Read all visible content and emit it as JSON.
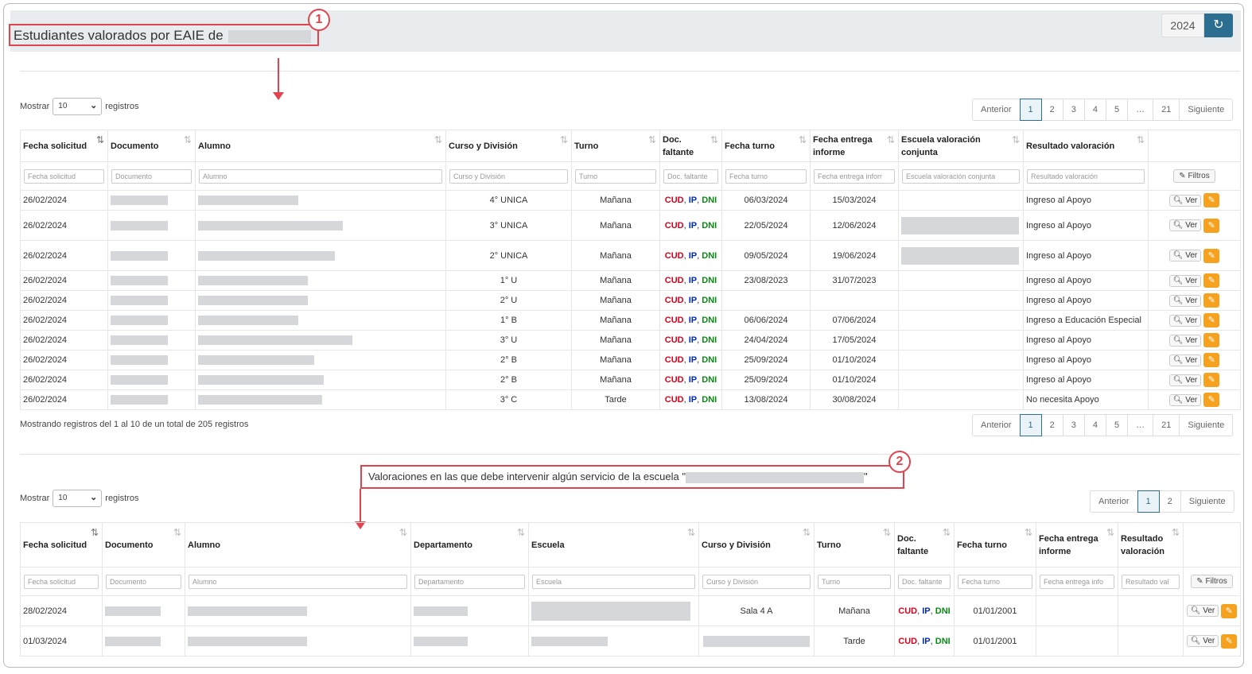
{
  "header": {
    "title": "Estudiantes valorados por EAIE de",
    "year": "2024",
    "badge1": "1",
    "badge2": "2"
  },
  "icons": {
    "refresh": "refresh-icon",
    "sort": "sort-icon",
    "search": "search-icon",
    "edit": "pencil-icon",
    "eraser": "eraser-icon",
    "chevron": "chevron-down-icon"
  },
  "colors": {
    "accent": "#2c6e8f",
    "callout": "#e0454f",
    "edit": "#f6a21e",
    "cud": "#d9001b",
    "ip": "#0029c4",
    "dni": "#0a8a14"
  },
  "table1": {
    "show_prefix": "Mostrar",
    "show_value": "10",
    "show_suffix": "registros",
    "pager": [
      "Anterior",
      "1",
      "2",
      "3",
      "4",
      "5",
      "…",
      "21",
      "Siguiente"
    ],
    "headers": [
      "Fecha solicitud",
      "Documento",
      "Alumno",
      "Curso y División",
      "Turno",
      "Doc. faltante",
      "Fecha turno",
      "Fecha entrega informe",
      "Escuela valoración conjunta",
      "Resultado valoración",
      ""
    ],
    "filters": [
      "Fecha solicitud",
      "Documento",
      "Alumno",
      "Curso y División",
      "Turno",
      "Doc. faltante",
      "Fecha turno",
      "Fecha entrega inforr",
      "Escuela valoración conjunta",
      "Resultado valoración"
    ],
    "filtros_label": "Filtros",
    "rows": [
      {
        "fecha": "26/02/2024",
        "curso": "4° UNICA",
        "turno": "Mañana",
        "fturno": "06/03/2024",
        "fentrega": "15/03/2024",
        "resultado": "Ingreso al Apoyo"
      },
      {
        "fecha": "26/02/2024",
        "curso": "3° UNICA",
        "turno": "Mañana",
        "fturno": "22/05/2024",
        "fentrega": "12/06/2024",
        "resultado": "Ingreso al Apoyo"
      },
      {
        "fecha": "26/02/2024",
        "curso": "2° UNICA",
        "turno": "Mañana",
        "fturno": "09/05/2024",
        "fentrega": "19/06/2024",
        "resultado": "Ingreso al Apoyo"
      },
      {
        "fecha": "26/02/2024",
        "curso": "1° U",
        "turno": "Mañana",
        "fturno": "23/08/2023",
        "fentrega": "31/07/2023",
        "resultado": "Ingreso al Apoyo"
      },
      {
        "fecha": "26/02/2024",
        "curso": "2° U",
        "turno": "Mañana",
        "fturno": "",
        "fentrega": "",
        "resultado": "Ingreso al Apoyo"
      },
      {
        "fecha": "26/02/2024",
        "curso": "1° B",
        "turno": "Mañana",
        "fturno": "06/06/2024",
        "fentrega": "07/06/2024",
        "resultado": "Ingreso a Educación Especial"
      },
      {
        "fecha": "26/02/2024",
        "curso": "3° U",
        "turno": "Mañana",
        "fturno": "24/04/2024",
        "fentrega": "17/05/2024",
        "resultado": "Ingreso al Apoyo"
      },
      {
        "fecha": "26/02/2024",
        "curso": "2° B",
        "turno": "Mañana",
        "fturno": "25/09/2024",
        "fentrega": "01/10/2024",
        "resultado": "Ingreso al Apoyo"
      },
      {
        "fecha": "26/02/2024",
        "curso": "2° B",
        "turno": "Mañana",
        "fturno": "25/09/2024",
        "fentrega": "01/10/2024",
        "resultado": "Ingreso al Apoyo"
      },
      {
        "fecha": "26/02/2024",
        "curso": "3° C",
        "turno": "Tarde",
        "fturno": "13/08/2024",
        "fentrega": "30/08/2024",
        "resultado": "No necesita Apoyo"
      }
    ],
    "doc_parts": [
      "CUD",
      "IP",
      "DNI"
    ],
    "ver_label": "Ver",
    "footer_info": "Mostrando registros del 1 al 10 de un total de 205 registros"
  },
  "callout2": {
    "text_prefix": "Valoraciones en las que debe intervenir algún servicio de la escuela \"",
    "text_suffix": "\""
  },
  "table2": {
    "show_prefix": "Mostrar",
    "show_value": "10",
    "show_suffix": "registros",
    "pager": [
      "Anterior",
      "1",
      "2",
      "Siguiente"
    ],
    "headers": [
      "Fecha solicitud",
      "Documento",
      "Alumno",
      "Departamento",
      "Escuela",
      "Curso y División",
      "Turno",
      "Doc. faltante",
      "Fecha turno",
      "Fecha entrega informe",
      "Resultado valoración",
      ""
    ],
    "filters": [
      "Fecha solicitud",
      "Documento",
      "Alumno",
      "Departamento",
      "Escuela",
      "Curso y División",
      "Turno",
      "Doc. faltante",
      "Fecha turno",
      "Fecha entrega info",
      "Resultado val"
    ],
    "filtros_label": "Filtros",
    "rows": [
      {
        "fecha": "28/02/2024",
        "curso": "Sala 4 A",
        "turno": "Mañana",
        "fturno": "01/01/2001"
      },
      {
        "fecha": "01/03/2024",
        "curso": "",
        "turno": "Tarde",
        "fturno": "01/01/2001"
      }
    ],
    "ver_label": "Ver"
  }
}
